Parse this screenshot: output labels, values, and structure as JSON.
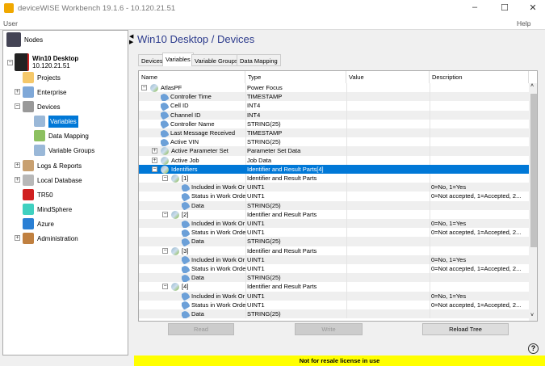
{
  "window": {
    "title": "deviceWISE Workbench 19.1.6  -  10.120.21.51"
  },
  "menu": {
    "user": "User",
    "help": "Help"
  },
  "sidebar": {
    "nodes_label": "Nodes",
    "device_name": "Win10 Desktop",
    "device_ip": "10.120.21.51",
    "items": [
      {
        "label": "Projects",
        "icon": "folder-icon",
        "color": "#f5c86a"
      },
      {
        "label": "Enterprise",
        "icon": "building-icon",
        "color": "#7fa8d8"
      },
      {
        "label": "Devices",
        "icon": "devices-icon",
        "color": "#999999"
      },
      {
        "label": "Variables",
        "icon": "variables-icon",
        "color": "#9ab8d8"
      },
      {
        "label": "Data Mapping",
        "icon": "data-mapping-icon",
        "color": "#8cc060"
      },
      {
        "label": "Variable Groups",
        "icon": "variable-groups-icon",
        "color": "#9ab8d8"
      },
      {
        "label": "Logs & Reports",
        "icon": "logbook-icon",
        "color": "#c8a070"
      },
      {
        "label": "Local Database",
        "icon": "database-icon",
        "color": "#b8b8b8"
      },
      {
        "label": "TR50",
        "icon": "tr50-icon",
        "color": "#d02020"
      },
      {
        "label": "MindSphere",
        "icon": "mindsphere-icon",
        "color": "#40d0c0"
      },
      {
        "label": "Azure",
        "icon": "azure-icon",
        "color": "#2a7fd4"
      },
      {
        "label": "Administration",
        "icon": "admin-icon",
        "color": "#c08040"
      }
    ]
  },
  "main": {
    "title": "Win10 Desktop / Devices",
    "tabs": [
      "Devices",
      "Variables",
      "Variable Groups",
      "Data Mapping"
    ],
    "active_tab": "Variables",
    "columns": [
      "Name",
      "Type",
      "Value",
      "Description"
    ],
    "rows": [
      {
        "name": "AtlasPF",
        "type": "Power Focus",
        "value": "",
        "desc": "",
        "level": 0,
        "group": true,
        "exp": "-"
      },
      {
        "name": "Controller Time",
        "type": "TIMESTAMP",
        "value": "",
        "desc": "",
        "level": 1
      },
      {
        "name": "Cell ID",
        "type": "INT4",
        "value": "",
        "desc": "",
        "level": 1
      },
      {
        "name": "Channel ID",
        "type": "INT4",
        "value": "",
        "desc": "",
        "level": 1
      },
      {
        "name": "Controller Name",
        "type": "STRING(25)",
        "value": "",
        "desc": "",
        "level": 1
      },
      {
        "name": "Last Message Received",
        "type": "TIMESTAMP",
        "value": "",
        "desc": "",
        "level": 1
      },
      {
        "name": "Active VIN",
        "type": "STRING(25)",
        "value": "",
        "desc": "",
        "level": 1
      },
      {
        "name": "Active Parameter Set",
        "type": "Parameter Set Data",
        "value": "",
        "desc": "",
        "level": 1,
        "group": true,
        "exp": "+"
      },
      {
        "name": "Active Job",
        "type": "Job Data",
        "value": "",
        "desc": "",
        "level": 1,
        "group": true,
        "exp": "+"
      },
      {
        "name": "Identifiers",
        "type": "Identifier and Result Parts[4]",
        "value": "",
        "desc": "",
        "level": 1,
        "group": true,
        "exp": "-",
        "selected": true
      },
      {
        "name": "[1]",
        "type": "Identifier and Result Parts",
        "value": "",
        "desc": "",
        "level": 2,
        "group": true,
        "exp": "-"
      },
      {
        "name": "Included in Work Or",
        "type": "UINT1",
        "value": "",
        "desc": "0=No, 1=Yes",
        "level": 3
      },
      {
        "name": "Status in Work Orde",
        "type": "UINT1",
        "value": "",
        "desc": "0=Not accepted, 1=Accepted, 2...",
        "level": 3
      },
      {
        "name": "Data",
        "type": "STRING(25)",
        "value": "",
        "desc": "",
        "level": 3
      },
      {
        "name": "[2]",
        "type": "Identifier and Result Parts",
        "value": "",
        "desc": "",
        "level": 2,
        "group": true,
        "exp": "-"
      },
      {
        "name": "Included in Work Or",
        "type": "UINT1",
        "value": "",
        "desc": "0=No, 1=Yes",
        "level": 3
      },
      {
        "name": "Status in Work Orde",
        "type": "UINT1",
        "value": "",
        "desc": "0=Not accepted, 1=Accepted, 2...",
        "level": 3
      },
      {
        "name": "Data",
        "type": "STRING(25)",
        "value": "",
        "desc": "",
        "level": 3
      },
      {
        "name": "[3]",
        "type": "Identifier and Result Parts",
        "value": "",
        "desc": "",
        "level": 2,
        "group": true,
        "exp": "-"
      },
      {
        "name": "Included in Work Or",
        "type": "UINT1",
        "value": "",
        "desc": "0=No, 1=Yes",
        "level": 3
      },
      {
        "name": "Status in Work Orde",
        "type": "UINT1",
        "value": "",
        "desc": "0=Not accepted, 1=Accepted, 2...",
        "level": 3
      },
      {
        "name": "Data",
        "type": "STRING(25)",
        "value": "",
        "desc": "",
        "level": 3
      },
      {
        "name": "[4]",
        "type": "Identifier and Result Parts",
        "value": "",
        "desc": "",
        "level": 2,
        "group": true,
        "exp": "-"
      },
      {
        "name": "Included in Work Or",
        "type": "UINT1",
        "value": "",
        "desc": "0=No, 1=Yes",
        "level": 3
      },
      {
        "name": "Status in Work Orde",
        "type": "UINT1",
        "value": "",
        "desc": "0=Not accepted, 1=Accepted, 2...",
        "level": 3
      },
      {
        "name": "Data",
        "type": "STRING(25)",
        "value": "",
        "desc": "",
        "level": 3
      }
    ],
    "buttons": {
      "read": "Read",
      "write": "Write",
      "reload": "Reload Tree"
    },
    "license": "Not for resale license in use",
    "help": "?"
  },
  "colors": {
    "selection": "#0078d7",
    "title": "#2b3a8c",
    "license_bg": "#ffff00"
  }
}
